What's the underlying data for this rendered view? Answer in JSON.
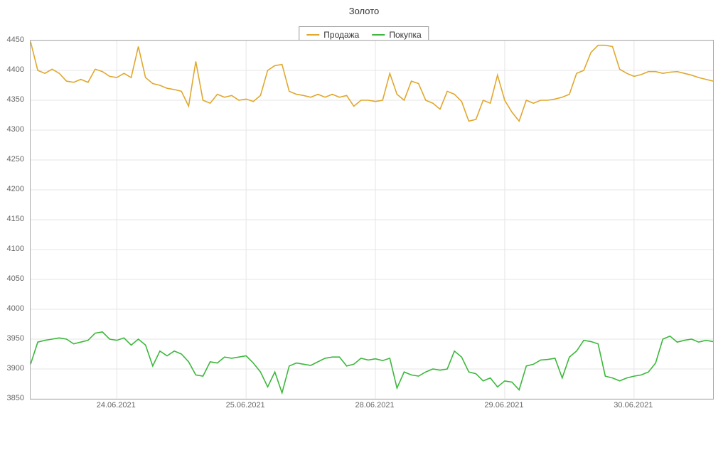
{
  "chart_data": {
    "type": "line",
    "title": "Золото",
    "xlabel": "",
    "ylabel": "",
    "ylim": [
      3850,
      4450
    ],
    "y_ticks": [
      3850,
      3900,
      3950,
      4000,
      4050,
      4100,
      4150,
      4200,
      4250,
      4300,
      4350,
      4400,
      4450
    ],
    "x_tick_labels": [
      "24.06.2021",
      "25.06.2021",
      "28.06.2021",
      "29.06.2021",
      "30.06.2021"
    ],
    "x_tick_positions": [
      12,
      30,
      48,
      66,
      84
    ],
    "legend": {
      "sell": "Продажа",
      "buy": "Покупка"
    },
    "colors": {
      "sell": "#e0a82e",
      "buy": "#3cb83c"
    },
    "n_points": 96,
    "series": [
      {
        "name": "Продажа",
        "key": "sell",
        "values": [
          4448,
          4400,
          4395,
          4402,
          4395,
          4382,
          4380,
          4385,
          4380,
          4402,
          4398,
          4390,
          4388,
          4395,
          4388,
          4440,
          4388,
          4378,
          4375,
          4370,
          4368,
          4365,
          4340,
          4415,
          4350,
          4345,
          4360,
          4355,
          4358,
          4350,
          4352,
          4348,
          4358,
          4400,
          4408,
          4410,
          4365,
          4360,
          4358,
          4355,
          4360,
          4355,
          4360,
          4355,
          4358,
          4340,
          4350,
          4350,
          4348,
          4350,
          4395,
          4360,
          4350,
          4382,
          4378,
          4350,
          4345,
          4335,
          4365,
          4360,
          4348,
          4315,
          4318,
          4350,
          4345,
          4392,
          4350,
          4330,
          4315,
          4350,
          4345,
          4350,
          4350,
          4352,
          4355,
          4360,
          4395,
          4400,
          4430,
          4442,
          4442,
          4440,
          4402,
          4395,
          4390,
          4393,
          4398,
          4398,
          4395,
          4397,
          4398,
          4395,
          4392,
          4388,
          4385,
          4382
        ]
      },
      {
        "name": "Покупка",
        "key": "buy",
        "values": [
          3908,
          3945,
          3948,
          3950,
          3952,
          3950,
          3942,
          3945,
          3948,
          3960,
          3962,
          3950,
          3948,
          3952,
          3940,
          3950,
          3940,
          3905,
          3930,
          3922,
          3930,
          3925,
          3912,
          3890,
          3888,
          3912,
          3910,
          3920,
          3918,
          3920,
          3922,
          3910,
          3895,
          3870,
          3895,
          3860,
          3905,
          3910,
          3908,
          3906,
          3912,
          3918,
          3920,
          3920,
          3905,
          3908,
          3918,
          3915,
          3917,
          3914,
          3918,
          3868,
          3895,
          3890,
          3888,
          3895,
          3900,
          3898,
          3900,
          3930,
          3920,
          3895,
          3892,
          3880,
          3885,
          3870,
          3880,
          3878,
          3865,
          3905,
          3908,
          3915,
          3916,
          3918,
          3885,
          3920,
          3930,
          3948,
          3946,
          3942,
          3888,
          3885,
          3880,
          3885,
          3888,
          3890,
          3895,
          3910,
          3950,
          3955,
          3945,
          3948,
          3950,
          3945,
          3948,
          3946
        ]
      }
    ]
  }
}
